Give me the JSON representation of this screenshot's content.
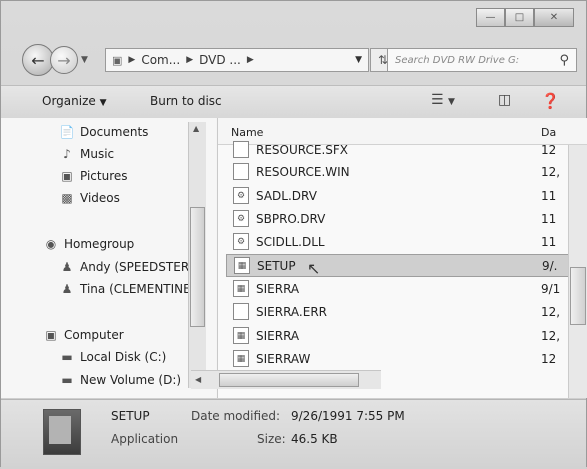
{
  "window": {
    "minimize_icon": "minimize-icon",
    "maximize_icon": "maximize-icon",
    "close_icon": "close-icon"
  },
  "navigation": {
    "breadcrumb": [
      "Com...",
      "DVD ...",
      ""
    ],
    "search_placeholder": "Search DVD RW Drive G:"
  },
  "toolbar": {
    "organize_label": "Organize",
    "burn_label": "Burn to disc"
  },
  "nav_pane": {
    "items": [
      {
        "label": "Documents",
        "icon": "documents-icon"
      },
      {
        "label": "Music",
        "icon": "music-icon"
      },
      {
        "label": "Pictures",
        "icon": "pictures-icon"
      },
      {
        "label": "Videos",
        "icon": "videos-icon"
      },
      {
        "label": "Homegroup",
        "icon": "homegroup-icon"
      },
      {
        "label": "Andy (SPEEDSTER",
        "icon": "user-icon"
      },
      {
        "label": "Tina (CLEMENTINE",
        "icon": "user-icon"
      },
      {
        "label": "Computer",
        "icon": "computer-icon"
      },
      {
        "label": "Local Disk (C:)",
        "icon": "disk-icon"
      },
      {
        "label": "New Volume (D:)",
        "icon": "disk-icon"
      }
    ]
  },
  "file_list": {
    "columns": {
      "name": "Name",
      "date": "Da"
    },
    "rows": [
      {
        "name": "RESOURCE.SFX",
        "date": "12"
      },
      {
        "name": "RESOURCE.WIN",
        "date": "12,"
      },
      {
        "name": "SADL.DRV",
        "date": "11"
      },
      {
        "name": "SBPRO.DRV",
        "date": "11"
      },
      {
        "name": "SCIDLL.DLL",
        "date": "11"
      },
      {
        "name": "SETUP",
        "date": "9/."
      },
      {
        "name": "SIERRA",
        "date": "9/1"
      },
      {
        "name": "SIERRA.ERR",
        "date": "12,"
      },
      {
        "name": "SIERRA",
        "date": "12,"
      },
      {
        "name": "SIERRAW",
        "date": "12"
      }
    ]
  },
  "details": {
    "name": "SETUP",
    "type": "Application",
    "date_label": "Date modified:",
    "date_value": "9/26/1991 7:55 PM",
    "size_label": "Size:",
    "size_value": "46.5 KB"
  }
}
